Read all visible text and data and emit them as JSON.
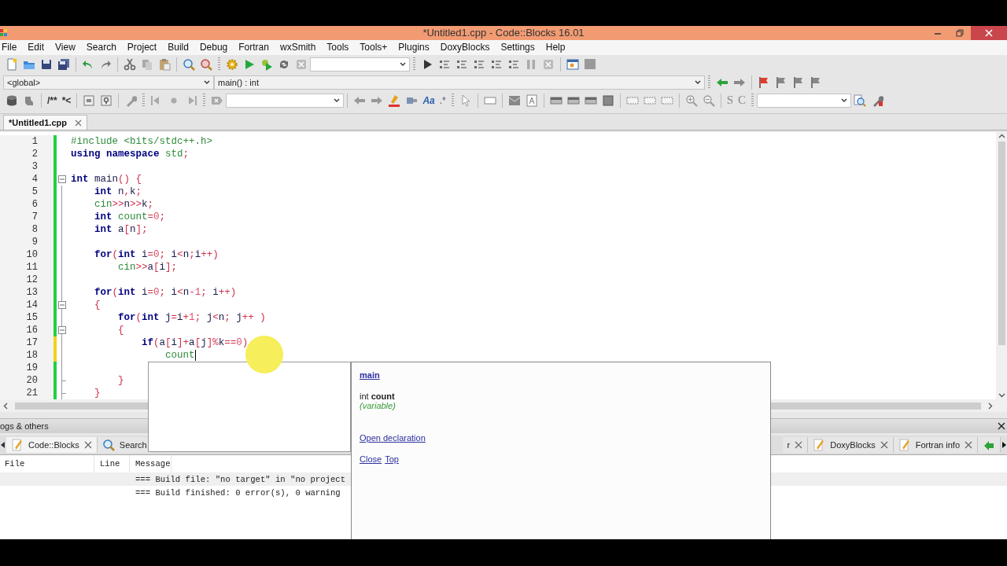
{
  "window": {
    "title": "*Untitled1.cpp - Code::Blocks 16.01"
  },
  "menu": [
    {
      "label": "File"
    },
    {
      "label": "Edit"
    },
    {
      "label": "View"
    },
    {
      "label": "Search"
    },
    {
      "label": "Project"
    },
    {
      "label": "Build"
    },
    {
      "label": "Debug"
    },
    {
      "label": "Fortran"
    },
    {
      "label": "wxSmith"
    },
    {
      "label": "Tools"
    },
    {
      "label": "Tools+"
    },
    {
      "label": "Plugins"
    },
    {
      "label": "DoxyBlocks"
    },
    {
      "label": "Settings"
    },
    {
      "label": "Help"
    }
  ],
  "scope_combo": {
    "value": "<global>"
  },
  "function_combo": {
    "value": "main() : int"
  },
  "code_toolbar": {
    "doxy_buttons": [
      "/**",
      "*<"
    ],
    "search_buttons": [
      "Aa",
      ".*"
    ],
    "letter_buttons": [
      "S",
      "C"
    ]
  },
  "editor_tabs": [
    {
      "label": "*Untitled1.cpp",
      "selected": true
    }
  ],
  "code": {
    "lines": [
      {
        "number": "1",
        "modified": false,
        "fold_start": false,
        "in_fold": false,
        "fold_end": false,
        "caret": false,
        "tokens": [
          {
            "kind": "pp",
            "text": "#include <bits/stdc++.h>"
          }
        ]
      },
      {
        "number": "2",
        "modified": false,
        "fold_start": false,
        "in_fold": false,
        "fold_end": false,
        "caret": false,
        "tokens": [
          {
            "kind": "kw",
            "text": "using namespace"
          },
          {
            "kind": "lib",
            "text": " std"
          },
          {
            "kind": "op",
            "text": ";"
          }
        ]
      },
      {
        "number": "3",
        "modified": false,
        "fold_start": false,
        "in_fold": false,
        "fold_end": false,
        "caret": false
      },
      {
        "number": "4",
        "modified": false,
        "fold_start": true,
        "in_fold": false,
        "fold_end": false,
        "caret": false,
        "tokens": [
          {
            "kind": "kw",
            "text": "int"
          },
          {
            "kind": "id",
            "text": " main"
          },
          {
            "kind": "op",
            "text": "() {"
          }
        ]
      },
      {
        "number": "5",
        "modified": false,
        "fold_start": false,
        "in_fold": true,
        "fold_end": false,
        "caret": false,
        "tokens": [
          {
            "kind": "kw",
            "text": "    int"
          },
          {
            "kind": "id",
            "text": " n"
          },
          {
            "kind": "op",
            "text": ","
          },
          {
            "kind": "id",
            "text": "k"
          },
          {
            "kind": "op",
            "text": ";"
          }
        ]
      },
      {
        "number": "6",
        "modified": false,
        "fold_start": false,
        "in_fold": true,
        "fold_end": false,
        "caret": false,
        "tokens": [
          {
            "kind": "lib",
            "text": "    cin"
          },
          {
            "kind": "op",
            "text": ">>"
          },
          {
            "kind": "id",
            "text": "n"
          },
          {
            "kind": "op",
            "text": ">>"
          },
          {
            "kind": "id",
            "text": "k"
          },
          {
            "kind": "op",
            "text": ";"
          }
        ]
      },
      {
        "number": "7",
        "modified": false,
        "fold_start": false,
        "in_fold": true,
        "fold_end": false,
        "caret": false,
        "tokens": [
          {
            "kind": "kw",
            "text": "    int"
          },
          {
            "kind": "lib",
            "text": " count"
          },
          {
            "kind": "op",
            "text": "="
          },
          {
            "kind": "num",
            "text": "0"
          },
          {
            "kind": "op",
            "text": ";"
          }
        ]
      },
      {
        "number": "8",
        "modified": false,
        "fold_start": false,
        "in_fold": true,
        "fold_end": false,
        "caret": false,
        "tokens": [
          {
            "kind": "kw",
            "text": "    int"
          },
          {
            "kind": "id",
            "text": " a"
          },
          {
            "kind": "op",
            "text": "["
          },
          {
            "kind": "id",
            "text": "n"
          },
          {
            "kind": "op",
            "text": "];"
          }
        ]
      },
      {
        "number": "9",
        "modified": false,
        "fold_start": false,
        "in_fold": true,
        "fold_end": false,
        "caret": false
      },
      {
        "number": "10",
        "modified": false,
        "fold_start": false,
        "in_fold": true,
        "fold_end": false,
        "caret": false,
        "tokens": [
          {
            "kind": "kw",
            "text": "    for"
          },
          {
            "kind": "op",
            "text": "("
          },
          {
            "kind": "kw",
            "text": "int"
          },
          {
            "kind": "id",
            "text": " i"
          },
          {
            "kind": "op",
            "text": "="
          },
          {
            "kind": "num",
            "text": "0"
          },
          {
            "kind": "op",
            "text": ";"
          },
          {
            "kind": "id",
            "text": " i"
          },
          {
            "kind": "op",
            "text": "<"
          },
          {
            "kind": "id",
            "text": "n"
          },
          {
            "kind": "op",
            "text": ";"
          },
          {
            "kind": "id",
            "text": "i"
          },
          {
            "kind": "op",
            "text": "++)"
          }
        ]
      },
      {
        "number": "11",
        "modified": false,
        "fold_start": false,
        "in_fold": true,
        "fold_end": false,
        "caret": false,
        "tokens": [
          {
            "kind": "lib",
            "text": "        cin"
          },
          {
            "kind": "op",
            "text": ">>"
          },
          {
            "kind": "id",
            "text": "a"
          },
          {
            "kind": "op",
            "text": "["
          },
          {
            "kind": "id",
            "text": "i"
          },
          {
            "kind": "op",
            "text": "];"
          }
        ]
      },
      {
        "number": "12",
        "modified": false,
        "fold_start": false,
        "in_fold": true,
        "fold_end": false,
        "caret": false
      },
      {
        "number": "13",
        "modified": false,
        "fold_start": false,
        "in_fold": true,
        "fold_end": false,
        "caret": false,
        "tokens": [
          {
            "kind": "kw",
            "text": "    for"
          },
          {
            "kind": "op",
            "text": "("
          },
          {
            "kind": "kw",
            "text": "int"
          },
          {
            "kind": "id",
            "text": " i"
          },
          {
            "kind": "op",
            "text": "="
          },
          {
            "kind": "num",
            "text": "0"
          },
          {
            "kind": "op",
            "text": ";"
          },
          {
            "kind": "id",
            "text": " i"
          },
          {
            "kind": "op",
            "text": "<"
          },
          {
            "kind": "id",
            "text": "n"
          },
          {
            "kind": "op",
            "text": "-"
          },
          {
            "kind": "num",
            "text": "1"
          },
          {
            "kind": "op",
            "text": ";"
          },
          {
            "kind": "id",
            "text": " i"
          },
          {
            "kind": "op",
            "text": "++)"
          }
        ]
      },
      {
        "number": "14",
        "modified": false,
        "fold_start": true,
        "in_fold": true,
        "fold_end": false,
        "caret": false,
        "tokens": [
          {
            "kind": "op",
            "text": "    {"
          }
        ]
      },
      {
        "number": "15",
        "modified": false,
        "fold_start": false,
        "in_fold": true,
        "fold_end": false,
        "caret": false,
        "tokens": [
          {
            "kind": "kw",
            "text": "        for"
          },
          {
            "kind": "op",
            "text": "("
          },
          {
            "kind": "kw",
            "text": "int"
          },
          {
            "kind": "id",
            "text": " j"
          },
          {
            "kind": "op",
            "text": "="
          },
          {
            "kind": "id",
            "text": "i"
          },
          {
            "kind": "op",
            "text": "+"
          },
          {
            "kind": "num",
            "text": "1"
          },
          {
            "kind": "op",
            "text": ";"
          },
          {
            "kind": "id",
            "text": " j"
          },
          {
            "kind": "op",
            "text": "<"
          },
          {
            "kind": "id",
            "text": "n"
          },
          {
            "kind": "op",
            "text": ";"
          },
          {
            "kind": "id",
            "text": " j"
          },
          {
            "kind": "op",
            "text": "++ )"
          }
        ]
      },
      {
        "number": "16",
        "modified": false,
        "fold_start": true,
        "in_fold": true,
        "fold_end": false,
        "caret": false,
        "tokens": [
          {
            "kind": "op",
            "text": "        {"
          }
        ]
      },
      {
        "number": "17",
        "modified": true,
        "fold_start": false,
        "in_fold": true,
        "fold_end": false,
        "caret": false,
        "tokens": [
          {
            "kind": "kw",
            "text": "            if"
          },
          {
            "kind": "op",
            "text": "("
          },
          {
            "kind": "id",
            "text": "a"
          },
          {
            "kind": "op",
            "text": "["
          },
          {
            "kind": "id",
            "text": "i"
          },
          {
            "kind": "op",
            "text": "]+"
          },
          {
            "kind": "id",
            "text": "a"
          },
          {
            "kind": "op",
            "text": "["
          },
          {
            "kind": "id",
            "text": "j"
          },
          {
            "kind": "op",
            "text": "]%"
          },
          {
            "kind": "id",
            "text": "k"
          },
          {
            "kind": "op",
            "text": "=="
          },
          {
            "kind": "num",
            "text": "0"
          },
          {
            "kind": "op",
            "text": ")"
          }
        ]
      },
      {
        "number": "18",
        "modified": true,
        "fold_start": false,
        "in_fold": true,
        "fold_end": false,
        "caret": true,
        "tokens": [
          {
            "kind": "lib",
            "text": "                count"
          }
        ]
      },
      {
        "number": "19",
        "modified": false,
        "fold_start": false,
        "in_fold": true,
        "fold_end": false,
        "caret": false
      },
      {
        "number": "20",
        "modified": false,
        "fold_start": false,
        "in_fold": true,
        "fold_end": true,
        "caret": false,
        "tokens": [
          {
            "kind": "op",
            "text": "        }"
          }
        ]
      },
      {
        "number": "21",
        "modified": false,
        "fold_start": false,
        "in_fold": true,
        "fold_end": true,
        "caret": false,
        "tokens": [
          {
            "kind": "op",
            "text": "    }"
          }
        ]
      }
    ]
  },
  "doc_popup": {
    "scope_link": "main",
    "declaration": "int **count**",
    "kind_label": "(variable)",
    "links": [
      "Open declaration"
    ],
    "footer_links": [
      "Close",
      "Top"
    ]
  },
  "logs": {
    "title": "ogs & others",
    "tabs_left": [
      {
        "label": "Code::Blocks",
        "selected": true
      },
      {
        "label": "Search",
        "selected": false
      }
    ],
    "tabs_right": [
      {
        "label": "r",
        "selected": false
      },
      {
        "label": "DoxyBlocks",
        "selected": false
      },
      {
        "label": "Fortran info",
        "selected": false
      }
    ],
    "columns": [
      "File",
      "Line",
      "Message"
    ],
    "rows": [
      {
        "message": "=== Build file: \"no target\" in \"no project",
        "selected": true
      },
      {
        "message": "=== Build finished: 0 error(s), 0 warning",
        "selected": false
      }
    ]
  }
}
